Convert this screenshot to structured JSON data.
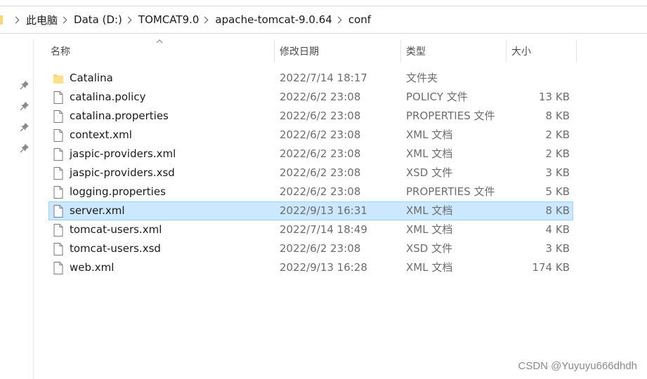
{
  "address_bar": {
    "crumbs": [
      "此电脑",
      "Data (D:)",
      "TOMCAT9.0",
      "apache-tomcat-9.0.64",
      "conf"
    ]
  },
  "columns": {
    "name": "名称",
    "date": "修改日期",
    "type": "类型",
    "size": "大小"
  },
  "files": [
    {
      "name": "Catalina",
      "date": "2022/7/14 18:17",
      "type": "文件夹",
      "size": "",
      "icon": "folder-icon"
    },
    {
      "name": "catalina.policy",
      "date": "2022/6/2 23:08",
      "type": "POLICY 文件",
      "size": "13 KB",
      "icon": "file-icon"
    },
    {
      "name": "catalina.properties",
      "date": "2022/6/2 23:08",
      "type": "PROPERTIES 文件",
      "size": "8 KB",
      "icon": "file-icon"
    },
    {
      "name": "context.xml",
      "date": "2022/6/2 23:08",
      "type": "XML 文档",
      "size": "2 KB",
      "icon": "file-icon"
    },
    {
      "name": "jaspic-providers.xml",
      "date": "2022/6/2 23:08",
      "type": "XML 文档",
      "size": "2 KB",
      "icon": "file-icon"
    },
    {
      "name": "jaspic-providers.xsd",
      "date": "2022/6/2 23:08",
      "type": "XSD 文件",
      "size": "3 KB",
      "icon": "file-icon"
    },
    {
      "name": "logging.properties",
      "date": "2022/6/2 23:08",
      "type": "PROPERTIES 文件",
      "size": "5 KB",
      "icon": "file-icon"
    },
    {
      "name": "server.xml",
      "date": "2022/9/13 16:31",
      "type": "XML 文档",
      "size": "8 KB",
      "icon": "file-icon",
      "selected": true
    },
    {
      "name": "tomcat-users.xml",
      "date": "2022/7/14 18:49",
      "type": "XML 文档",
      "size": "4 KB",
      "icon": "file-icon"
    },
    {
      "name": "tomcat-users.xsd",
      "date": "2022/6/2 23:08",
      "type": "XSD 文件",
      "size": "3 KB",
      "icon": "file-icon"
    },
    {
      "name": "web.xml",
      "date": "2022/9/13 16:28",
      "type": "XML 文档",
      "size": "174 KB",
      "icon": "file-icon"
    }
  ],
  "watermark": "CSDN @Yuyuyu666dhdh",
  "colors": {
    "selection_bg": "#cce8ff",
    "selection_border": "#99d1ff",
    "folder": "#f8d775"
  }
}
